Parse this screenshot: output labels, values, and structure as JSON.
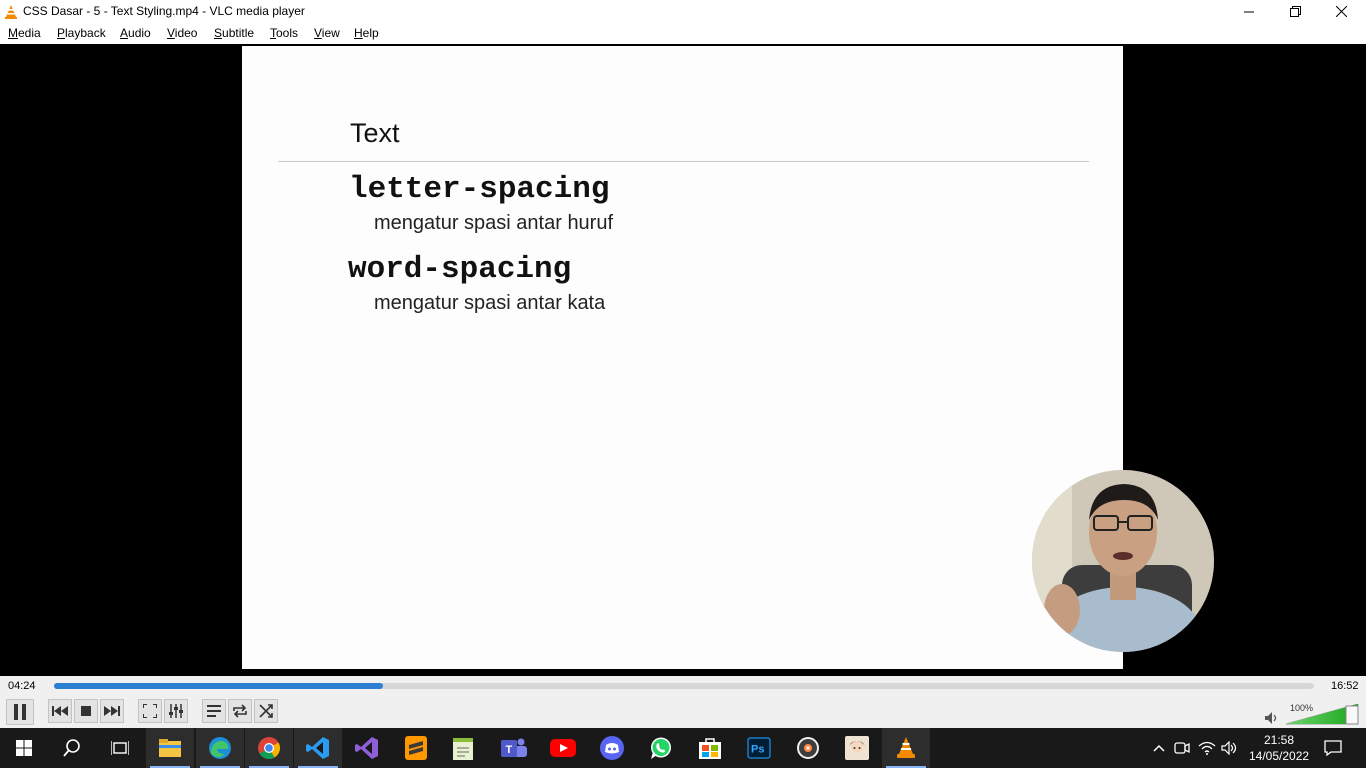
{
  "window": {
    "title": "CSS Dasar - 5 - Text Styling.mp4 - VLC media player"
  },
  "menu": [
    "Media",
    "Playback",
    "Audio",
    "Video",
    "Subtitle",
    "Tools",
    "View",
    "Help"
  ],
  "slide": {
    "heading": "Text",
    "items": [
      {
        "term": "letter-spacing",
        "desc": "mengatur spasi antar huruf"
      },
      {
        "term": "word-spacing",
        "desc": "mengatur spasi antar kata"
      }
    ]
  },
  "player": {
    "elapsed": "04:24",
    "duration": "16:52",
    "progress_fraction": 0.261,
    "volume_label": "100%",
    "volume_fraction": 1.0
  },
  "taskbar": {
    "apps": [
      "start-icon",
      "search-icon",
      "task-view-icon",
      "file-explorer-icon",
      "edge-icon",
      "chrome-icon",
      "vscode-icon",
      "visual-studio-icon",
      "sublime-text-icon",
      "notepad-plus-icon",
      "teams-icon",
      "youtube-icon",
      "discord-icon",
      "whatsapp-icon",
      "store-icon",
      "photoshop-icon",
      "media-app-icon",
      "anime-app-icon",
      "vlc-icon"
    ],
    "time": "21:58",
    "date": "14/05/2022"
  },
  "colors": {
    "accent": "#2d7fd3",
    "vlc_orange": "#f28a00",
    "taskbar_bg": "#191919"
  }
}
